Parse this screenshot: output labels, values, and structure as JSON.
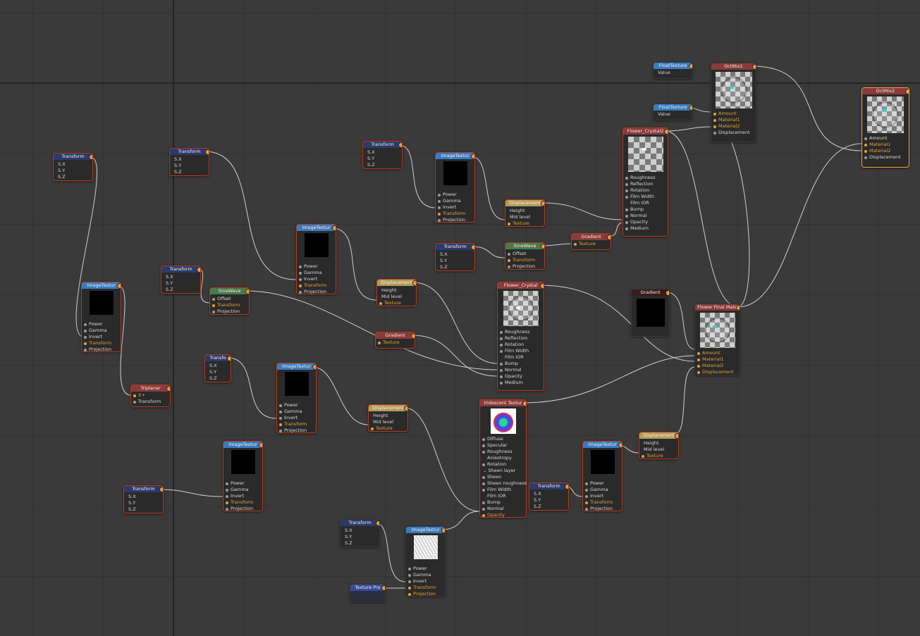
{
  "colors": {
    "transform": "#2b3a6a",
    "image": "#3a7bbf",
    "displacement": "#b59a5a",
    "gradient": "#8a3a3a",
    "sinewave": "#4a7a4a",
    "material": "#8a3a3a",
    "float": "#3a7bbf",
    "mix": "#8a3a3a",
    "triplanar": "#8a3a3a",
    "texproj": "#3a4a9a",
    "iridescent": "#8a3a3a",
    "output_pin": "#e8a03a"
  },
  "nodes": {
    "t1": {
      "title": "Transform",
      "pins": [
        "S.X",
        "S.Y",
        "S.Z"
      ]
    },
    "t2": {
      "title": "Transform",
      "pins": [
        "S.X",
        "S.Y",
        "S.Z"
      ]
    },
    "t3": {
      "title": "Transform",
      "pins": [
        "S.X",
        "S.Y",
        "S.Z"
      ]
    },
    "t4": {
      "title": "Transform",
      "pins": [
        "S.X",
        "S.Y",
        "S.Z"
      ]
    },
    "t5": {
      "title": "Transfo",
      "pins": [
        "S.X",
        "S.Y",
        "S.Z"
      ]
    },
    "t6": {
      "title": "Transform",
      "pins": [
        "S.X",
        "S.Y",
        "S.Z"
      ]
    },
    "t7": {
      "title": "Transform",
      "pins": [
        "S.X",
        "S.Y",
        "S.Z"
      ]
    },
    "t8": {
      "title": "Transform",
      "pins": [
        "S.X",
        "S.Y",
        "S.Z"
      ]
    },
    "t9": {
      "title": "Transform",
      "pins": [
        "S.X",
        "S.Y",
        "S.Z"
      ]
    },
    "img1": {
      "title": "ImageTextur",
      "pins": [
        "Power",
        "Gamma",
        "Invert",
        "Transform",
        "Projection"
      ]
    },
    "img2": {
      "title": "ImageTextur",
      "pins": [
        "Power",
        "Gamma",
        "Invert",
        "Transform",
        "Projection"
      ]
    },
    "img3": {
      "title": "ImageTextur",
      "pins": [
        "Power",
        "Gamma",
        "Invert",
        "Transform",
        "Projection"
      ]
    },
    "img4": {
      "title": "ImageTextur",
      "pins": [
        "Power",
        "Gamma",
        "Invert",
        "Transform",
        "Projection"
      ]
    },
    "img5": {
      "title": "ImageTextur",
      "pins": [
        "Power",
        "Gamma",
        "Invert",
        "Transform",
        "Projection"
      ]
    },
    "img6": {
      "title": "ImageTextur",
      "pins": [
        "Power",
        "Gamma",
        "Invert",
        "Transform",
        "Projection"
      ]
    },
    "img7": {
      "title": "ImageTextur",
      "pins": [
        "Power",
        "Gamma",
        "Invert",
        "Transform",
        "Projection"
      ]
    },
    "disp1": {
      "title": "Displacement",
      "pins": [
        "Height",
        "Mid level",
        "Texture"
      ]
    },
    "disp2": {
      "title": "Displacement",
      "pins": [
        "Height",
        "Mid level",
        "Texture"
      ]
    },
    "disp3": {
      "title": "Displacement",
      "pins": [
        "Height",
        "Mid level",
        "Texture"
      ]
    },
    "disp4": {
      "title": "Displacement",
      "pins": [
        "Height",
        "Mid level",
        "Texture"
      ]
    },
    "sine1": {
      "title": "SineWave",
      "pins": [
        "Offset",
        "Transform",
        "Projection"
      ]
    },
    "sine2": {
      "title": "SineWave",
      "pins": [
        "Offset",
        "Transform",
        "Projection"
      ]
    },
    "grad1": {
      "title": "Gradient",
      "pins": [
        "Texture"
      ]
    },
    "grad2": {
      "title": "Gradient",
      "pins": [
        "Texture"
      ]
    },
    "grad3": {
      "title": "Gradient"
    },
    "triplanar": {
      "title": "Triplanar",
      "pins": [
        "X+",
        "Transform"
      ]
    },
    "texproj": {
      "title": "Texture Pro"
    },
    "float1": {
      "title": "FloatTexture",
      "pins": [
        "Value"
      ]
    },
    "float2": {
      "title": "FloatTexture",
      "pins": [
        "Value"
      ]
    },
    "crystal2": {
      "title": "Flower_Crystal2",
      "pins": [
        "Roughness",
        "Reflection",
        "Rotation",
        "Film Width",
        "Film IOR",
        "Bump",
        "Normal",
        "Opacity",
        "Medium"
      ]
    },
    "crystal": {
      "title": "Flower_Crystal",
      "pins": [
        "Roughness",
        "Reflection",
        "Rotation",
        "Film Width",
        "Film IOR",
        "Bump",
        "Normal",
        "Opacity",
        "Medium"
      ]
    },
    "irid": {
      "title": "Iridescent Textur",
      "pins": [
        "Diffuse",
        "Specular",
        "Roughness",
        "Anisotropy",
        "Rotation",
        "⌄ Sheen layer",
        "Sheen",
        "Sheen roughness",
        "Film Width",
        "Film IOR",
        "Bump",
        "Normal",
        "Opacity"
      ]
    },
    "mix1": {
      "title": "OctMix1",
      "pins": [
        "Amount",
        "Material1",
        "Material2",
        "Displacement"
      ]
    },
    "mix2": {
      "title": "OctMix2",
      "pins": [
        "Amount",
        "Material1",
        "Material2",
        "Displacement"
      ]
    },
    "final": {
      "title": "Flower Final Mate",
      "pins": [
        "Amount",
        "Material1",
        "Material2",
        "Displacement"
      ]
    }
  }
}
